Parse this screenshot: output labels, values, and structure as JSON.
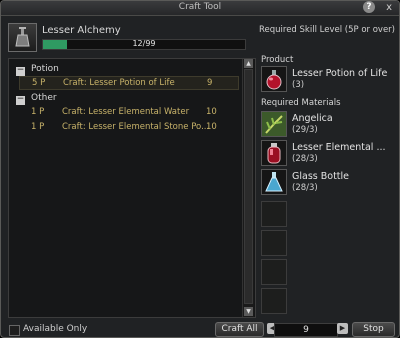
{
  "window": {
    "title": "Craft Tool",
    "help_glyph": "?",
    "close_glyph": "x"
  },
  "recipe": {
    "name": "Lesser Alchemy",
    "progress_text": "12/99",
    "progress_fraction": 0.121,
    "required_skill": "Required Skill Level (5P or over)"
  },
  "tree": {
    "categories": [
      {
        "label": "Potion",
        "toggle": "−",
        "items": [
          {
            "level": "5 P",
            "name": "Craft: Lesser Potion of Life",
            "count": "9",
            "selected": true
          }
        ]
      },
      {
        "label": "Other",
        "toggle": "−",
        "items": [
          {
            "level": "1 P",
            "name": "Craft: Lesser Elemental Water",
            "count": "10"
          },
          {
            "level": "1 P",
            "name": "Craft: Lesser Elemental Stone Po...",
            "count": "10"
          }
        ]
      }
    ]
  },
  "product": {
    "label": "Product",
    "name": "Lesser Potion of Life",
    "count": "(3)",
    "icon": "red-potion-icon"
  },
  "materials": {
    "label": "Required Materials",
    "items": [
      {
        "name": "Angelica",
        "count": "(29/3)",
        "icon": "herb-icon"
      },
      {
        "name": "Lesser Elemental ...",
        "count": "(28/3)",
        "icon": "red-vial-icon"
      },
      {
        "name": "Glass Bottle",
        "count": "(28/3)",
        "icon": "glass-bottle-icon"
      }
    ]
  },
  "bottom": {
    "available_only": "Available Only",
    "craft_all": "Craft All",
    "quantity": "9",
    "stop": "Stop",
    "prev_glyph": "◀",
    "next_glyph": "▶"
  },
  "colors": {
    "progress": "#2f9a62",
    "recipe_text": "#c8b36a"
  }
}
